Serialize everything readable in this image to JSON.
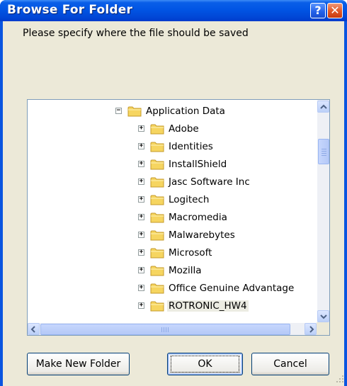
{
  "window": {
    "title": "Browse For Folder",
    "help_button": "?",
    "close_button": "✕"
  },
  "prompt": "Please specify where the file should be saved",
  "tree": {
    "items": [
      {
        "label": "Application Data",
        "expander": "−",
        "level": 1
      },
      {
        "label": "Adobe",
        "expander": "+",
        "level": 2
      },
      {
        "label": "Identities",
        "expander": "+",
        "level": 2
      },
      {
        "label": "InstallShield",
        "expander": "+",
        "level": 2
      },
      {
        "label": "Jasc Software Inc",
        "expander": "+",
        "level": 2
      },
      {
        "label": "Logitech",
        "expander": "+",
        "level": 2
      },
      {
        "label": "Macromedia",
        "expander": "+",
        "level": 2
      },
      {
        "label": "Malwarebytes",
        "expander": "+",
        "level": 2
      },
      {
        "label": "Microsoft",
        "expander": "+",
        "level": 2
      },
      {
        "label": "Mozilla",
        "expander": "+",
        "level": 2
      },
      {
        "label": "Office Genuine Advantage",
        "expander": "+",
        "level": 2
      },
      {
        "label": "ROTRONIC_HW4",
        "expander": "+",
        "level": 2,
        "selected": true
      }
    ]
  },
  "buttons": {
    "new_folder": "Make New Folder",
    "ok": "OK",
    "cancel": "Cancel"
  },
  "colors": {
    "titlebar": "#0155e4",
    "dialog_bg": "#ece9d8",
    "folder_yellow": "#f6d560"
  }
}
